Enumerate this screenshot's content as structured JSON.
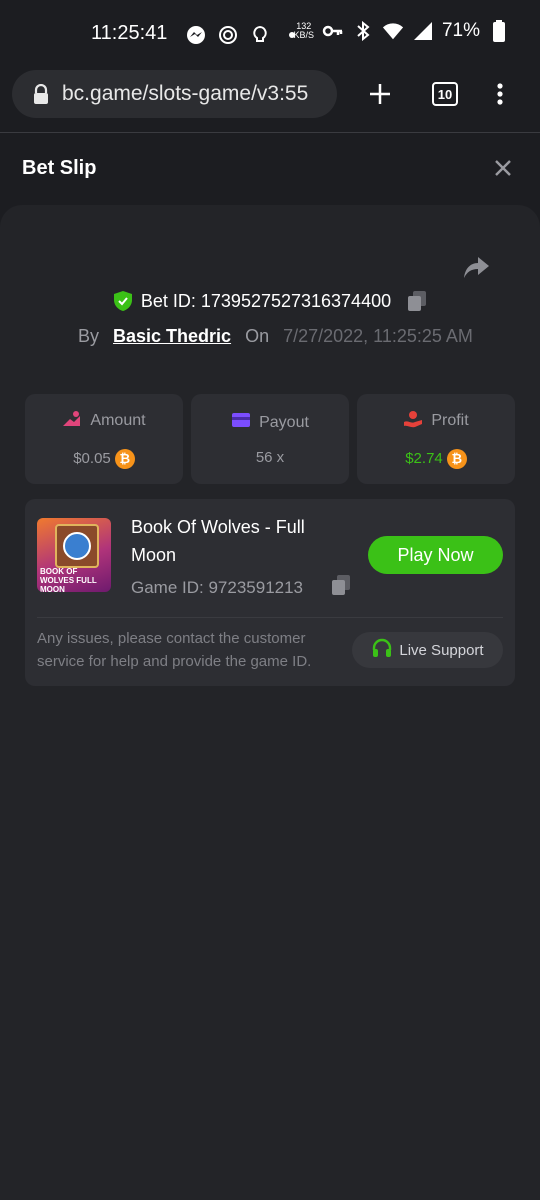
{
  "status_bar": {
    "time": "11:25:41",
    "net_speed_value": "132",
    "net_speed_unit": "KB/S",
    "battery": "71%",
    "icons": [
      "messenger-icon",
      "sync-icon",
      "bulb-icon",
      "dot-icon",
      "key-icon",
      "bluetooth-icon",
      "wifi-icon",
      "signal-icon",
      "battery-icon"
    ]
  },
  "browser": {
    "url": "bc.game/slots-game/v3:55",
    "tabs_count": "10"
  },
  "header": {
    "title": "Bet Slip"
  },
  "bet": {
    "id_text": "Bet ID: 1739527527316374400",
    "by_label": "By",
    "user": "Basic Thedric",
    "on_label": "On",
    "date": "7/27/2022, 11:25:25 AM"
  },
  "stats": [
    {
      "label": "Amount",
      "value": "$0.05",
      "icon": "amount-icon",
      "color": "#e0457b"
    },
    {
      "label": "Payout",
      "value": "56 x",
      "icon": "wallet-icon",
      "color": "#7b4dff"
    },
    {
      "label": "Profit",
      "value": "$2.74",
      "icon": "profit-icon",
      "color": "#e5413a"
    }
  ],
  "game": {
    "title": "Book Of Wolves - Full Moon",
    "thumb_text": "BOOK OF WOLVES FULL MOON",
    "game_id_text": "Game ID: 9723591213",
    "play_label": "Play Now",
    "support_note": "Any issues, please contact the customer service for help and provide the game ID.",
    "live_support_label": "Live Support"
  },
  "colors": {
    "accent_green": "#3bc117",
    "background": "#1c1d21",
    "panel": "#232428",
    "card": "#2d2e33"
  }
}
